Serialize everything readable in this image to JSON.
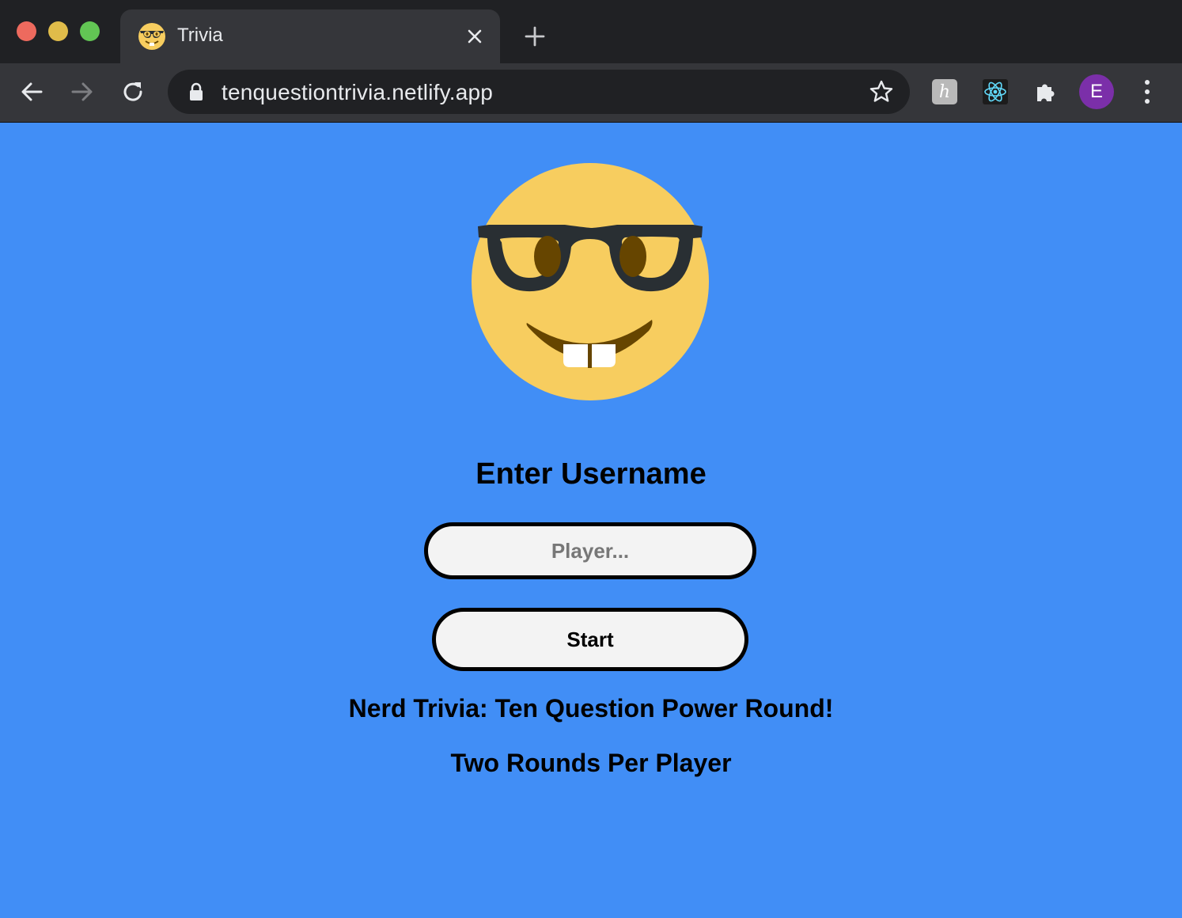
{
  "browser": {
    "tab": {
      "title": "Trivia",
      "favicon": "nerd-face-emoji"
    },
    "url": "tenquestiontrivia.netlify.app",
    "profile_initial": "E",
    "extensions": [
      "honey-extension-icon",
      "react-devtools-icon",
      "extensions-puzzle-icon"
    ],
    "ext_h_glyph": "h"
  },
  "page": {
    "background_color": "#418ef6",
    "emoji": "nerd-face",
    "heading": "Enter Username",
    "username_input": {
      "placeholder": "Player...",
      "value": ""
    },
    "start_button": "Start",
    "subtitle": "Nerd Trivia: Ten Question Power Round!",
    "rounds_text": "Two Rounds Per Player"
  }
}
